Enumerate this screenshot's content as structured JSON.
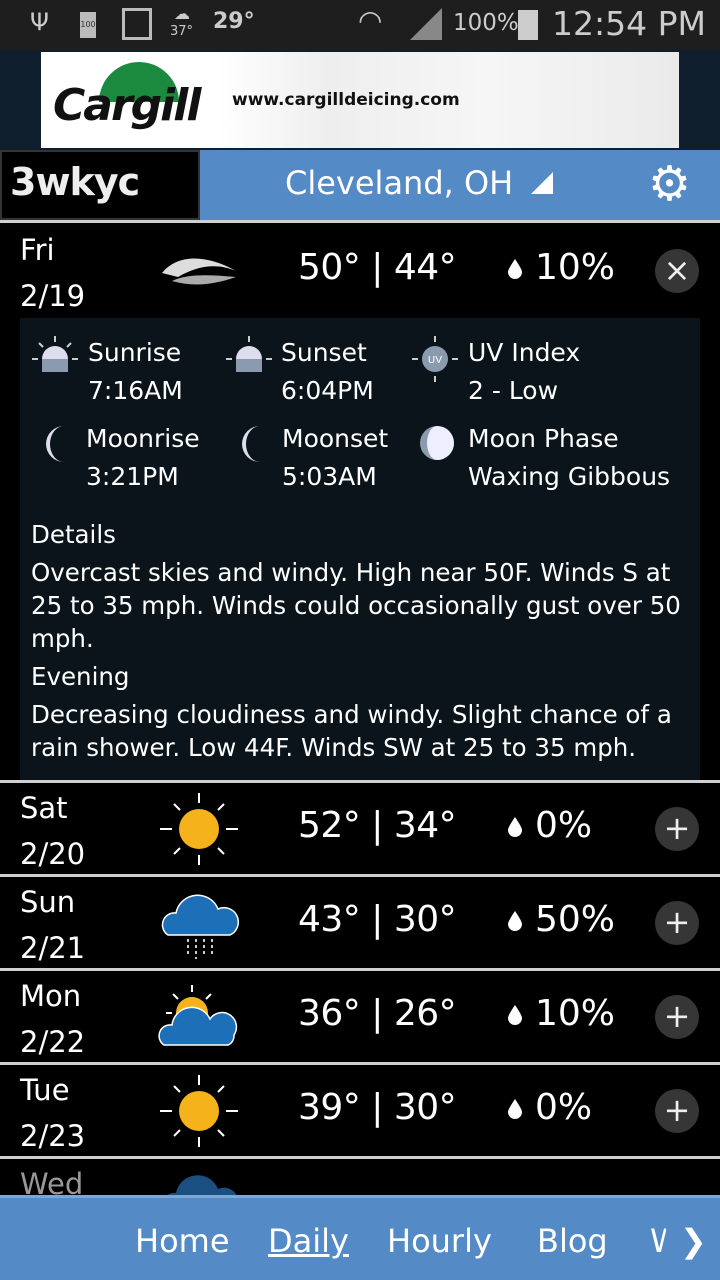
{
  "status_bar": {
    "notif_temp_small": "37°",
    "notif_temp": "29°",
    "battery_small": "100",
    "battery": "100%",
    "time": "12:54 PM"
  },
  "ad": {
    "brand": "Cargill",
    "url": "www.cargilldeicing.com"
  },
  "header": {
    "logo": "3wkyc",
    "location": "Cleveland, OH"
  },
  "colors": {
    "accent": "#548bc6",
    "sun": "#f5b21b",
    "cloud": "#1d6fb8"
  },
  "expanded": {
    "day": "Fri",
    "date": "2/19",
    "icon": "windy-icon",
    "high": "50°",
    "low": "44°",
    "precip": "10%",
    "sunrise_label": "Sunrise",
    "sunrise": "7:16AM",
    "sunset_label": "Sunset",
    "sunset": "6:04PM",
    "uv_label": "UV Index",
    "uv": "2 - Low",
    "moonrise_label": "Moonrise",
    "moonrise": "3:21PM",
    "moonset_label": "Moonset",
    "moonset": "5:03AM",
    "phase_label": "Moon Phase",
    "phase": "Waxing Gibbous",
    "details_label": "Details",
    "details": "Overcast skies and windy. High near 50F. Winds S at 25 to 35 mph. Winds could occasionally gust over 50 mph.",
    "evening_label": "Evening",
    "evening": "Decreasing cloudiness and windy. Slight chance of a rain shower. Low 44F. Winds SW at 25 to 35 mph."
  },
  "days": [
    {
      "day": "Sat",
      "date": "2/20",
      "icon": "sunny-icon",
      "high": "52°",
      "low": "34°",
      "precip": "0%"
    },
    {
      "day": "Sun",
      "date": "2/21",
      "icon": "rain-icon",
      "high": "43°",
      "low": "30°",
      "precip": "50%"
    },
    {
      "day": "Mon",
      "date": "2/22",
      "icon": "partly-cloudy-icon",
      "high": "36°",
      "low": "26°",
      "precip": "10%"
    },
    {
      "day": "Tue",
      "date": "2/23",
      "icon": "sunny-icon",
      "high": "39°",
      "low": "30°",
      "precip": "0%"
    },
    {
      "day": "Wed"
    }
  ],
  "nav": {
    "items": [
      "Home",
      "Daily",
      "Hourly",
      "Blog",
      "W"
    ],
    "active": "Daily"
  }
}
